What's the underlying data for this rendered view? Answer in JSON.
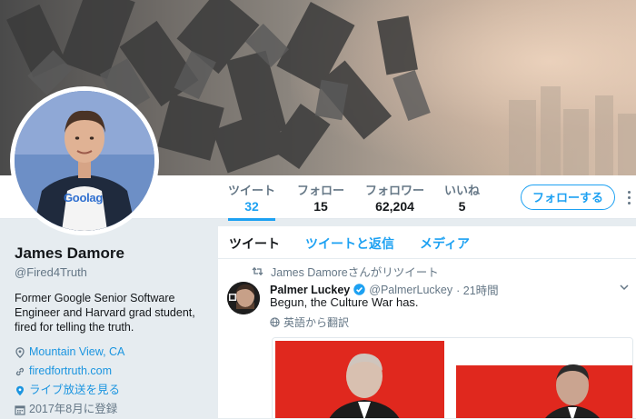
{
  "profile": {
    "name": "James Damore",
    "handle": "@Fired4Truth",
    "bio": "Former Google Senior Software Engineer and Harvard grad student, fired for telling the truth.",
    "location": "Mountain View, CA",
    "website": "firedfortruth.com",
    "broadcast": "ライブ放送を見る",
    "joined": "2017年8月に登録",
    "avatar_shirt_text": "Goolag"
  },
  "nav": {
    "tweets_label": "ツイート",
    "tweets_count": "32",
    "following_label": "フォロー",
    "following_count": "15",
    "followers_label": "フォロワー",
    "followers_count": "62,204",
    "likes_label": "いいね",
    "likes_count": "5",
    "follow_button": "フォローする"
  },
  "tabs": {
    "tweets": "ツイート",
    "tweets_replies": "ツイートと返信",
    "media": "メディア"
  },
  "tweet": {
    "retweet_context": "James Damoreさんがリツイート",
    "author_name": "Palmer Luckey",
    "author_handle": "@PalmerLuckey",
    "time": "· 21時間",
    "text": "Begun, the Culture War has.",
    "translate": "英語から翻訳"
  },
  "colors": {
    "accent": "#1da1f2",
    "link": "#1b95e0",
    "muted": "#657786",
    "page_bg": "#e6ecf0",
    "media_red": "#e0281e"
  },
  "icons": {
    "location": "location-pin-icon",
    "website": "link-icon",
    "broadcast": "broadcast-pin-icon",
    "joined": "calendar-icon",
    "retweet": "retweet-icon",
    "verified": "verified-badge-icon",
    "translate": "globe-icon",
    "more": "more-vertical-icon",
    "caret": "chevron-down-icon"
  }
}
